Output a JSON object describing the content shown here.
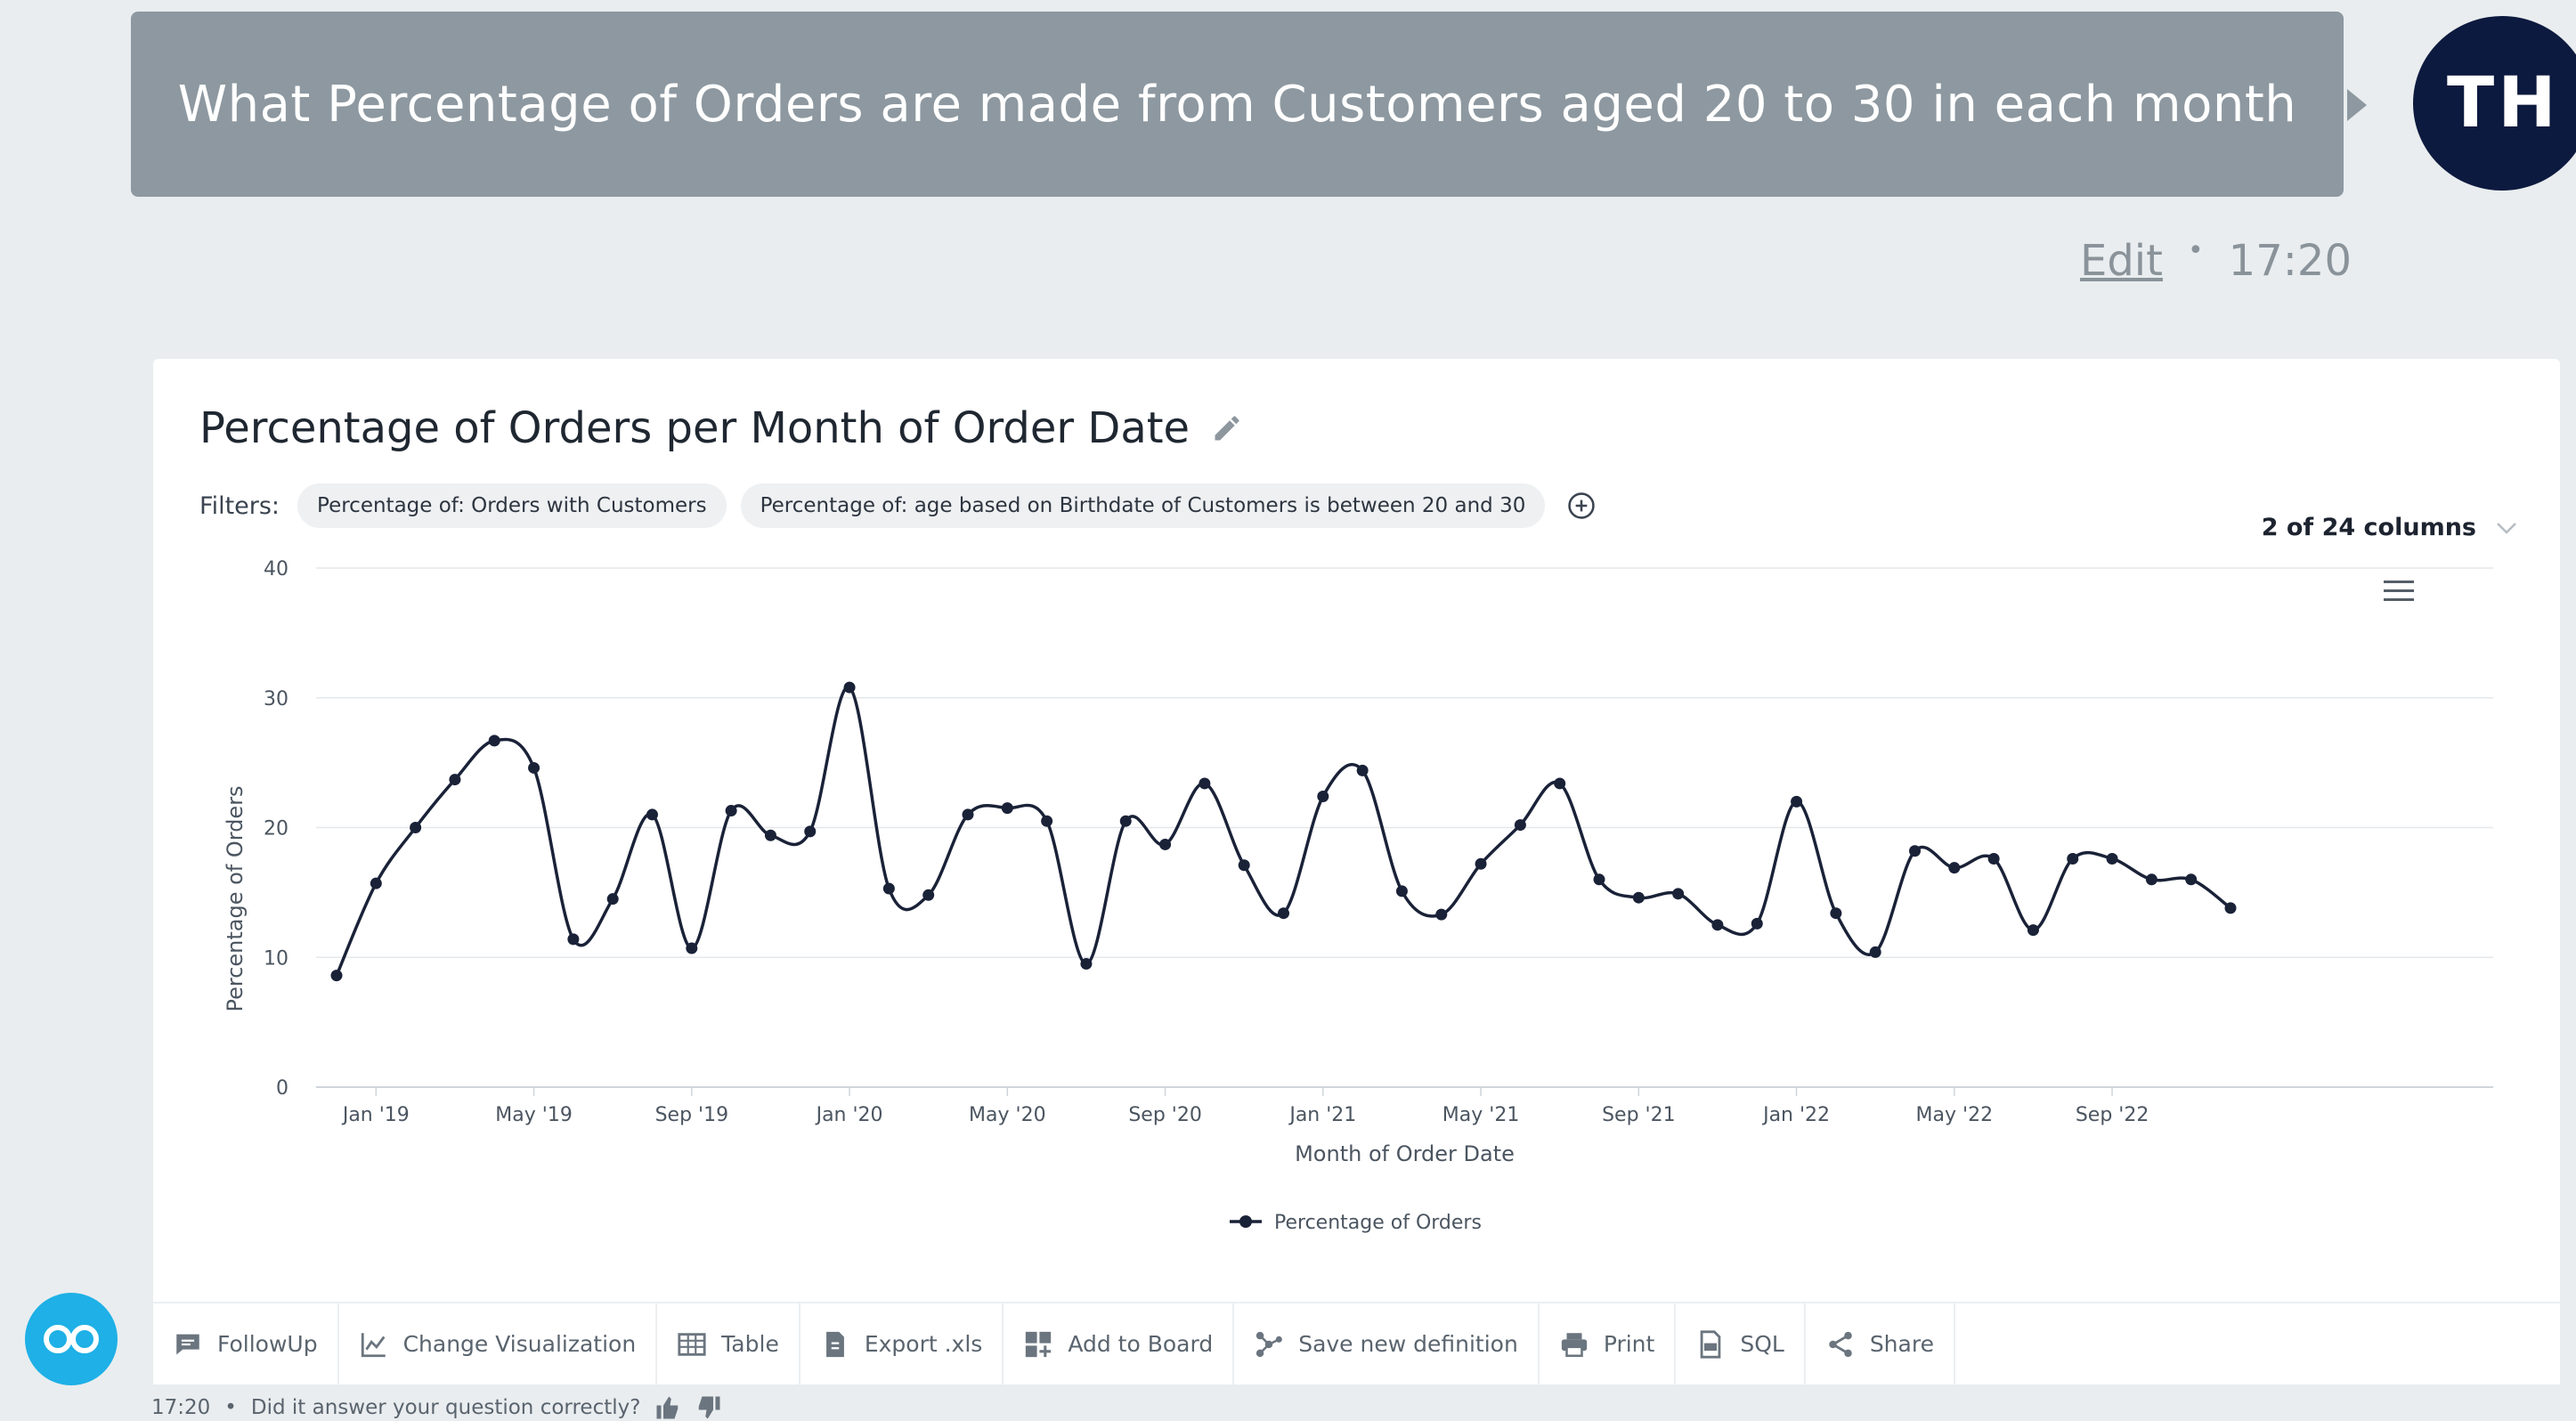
{
  "question": {
    "text": "What Percentage of Orders are made from Customers aged 20 to 30 in each month",
    "avatar": "TH",
    "edit_label": "Edit",
    "time": "17:20"
  },
  "card": {
    "title": "Percentage of Orders per Month of Order Date",
    "filters_label": "Filters:",
    "filters": [
      "Percentage of: Orders with Customers",
      "Percentage of: age based on Birthdate of Customers is between 20 and 30"
    ],
    "columns_label": "2 of 24 columns"
  },
  "chart_data": {
    "type": "line",
    "title": "Percentage of Orders per Month of Order Date",
    "xlabel": "Month of Order Date",
    "ylabel": "Percentage of Orders",
    "ylim": [
      0,
      40
    ],
    "yticks": [
      0,
      10,
      20,
      30,
      40
    ],
    "xtick_labels": [
      "Jan '19",
      "May '19",
      "Sep '19",
      "Jan '20",
      "May '20",
      "Sep '20",
      "Jan '21",
      "May '21",
      "Sep '21",
      "Jan '22",
      "May '22",
      "Sep '22"
    ],
    "x": [
      "2018-12",
      "2019-01",
      "2019-02",
      "2019-03",
      "2019-04",
      "2019-05",
      "2019-06",
      "2019-07",
      "2019-08",
      "2019-09",
      "2019-10",
      "2019-11",
      "2019-12",
      "2020-01",
      "2020-02",
      "2020-03",
      "2020-04",
      "2020-05",
      "2020-06",
      "2020-07",
      "2020-08",
      "2020-09",
      "2020-10",
      "2020-11",
      "2020-12",
      "2021-01",
      "2021-02",
      "2021-03",
      "2021-04",
      "2021-05",
      "2021-06",
      "2021-07",
      "2021-08",
      "2021-09",
      "2021-10",
      "2021-11",
      "2021-12",
      "2022-01",
      "2022-02",
      "2022-03",
      "2022-04",
      "2022-05",
      "2022-06",
      "2022-07",
      "2022-08",
      "2022-09",
      "2022-10",
      "2022-11",
      "2022-12"
    ],
    "series": [
      {
        "name": "Percentage of Orders",
        "values": [
          8.6,
          15.7,
          20.0,
          23.7,
          26.7,
          24.6,
          11.4,
          14.5,
          21.0,
          10.7,
          21.3,
          19.4,
          19.7,
          30.8,
          15.3,
          14.8,
          21.0,
          21.5,
          20.5,
          9.5,
          20.5,
          18.7,
          23.4,
          17.1,
          13.4,
          22.4,
          24.4,
          15.1,
          13.3,
          17.2,
          20.2,
          23.4,
          16.0,
          14.6,
          14.9,
          12.5,
          12.6,
          22.0,
          13.4,
          10.4,
          18.2,
          16.9,
          17.6,
          12.1,
          17.6,
          17.6,
          16.0,
          16.0,
          13.8
        ]
      }
    ],
    "legend": "bottom-center",
    "grid": true,
    "line_color": "#1a2238"
  },
  "toolbar": [
    {
      "label": "FollowUp",
      "icon": "followup-icon"
    },
    {
      "label": "Change Visualization",
      "icon": "chart-icon"
    },
    {
      "label": "Table",
      "icon": "table-icon"
    },
    {
      "label": "Export .xls",
      "icon": "export-icon"
    },
    {
      "label": "Add to Board",
      "icon": "board-icon"
    },
    {
      "label": "Save new definition",
      "icon": "save-definition-icon"
    },
    {
      "label": "Print",
      "icon": "print-icon"
    },
    {
      "label": "SQL",
      "icon": "sql-icon"
    },
    {
      "label": "Share",
      "icon": "share-icon"
    }
  ],
  "footer": {
    "time": "17:20",
    "question": "Did it answer your question correctly?"
  }
}
